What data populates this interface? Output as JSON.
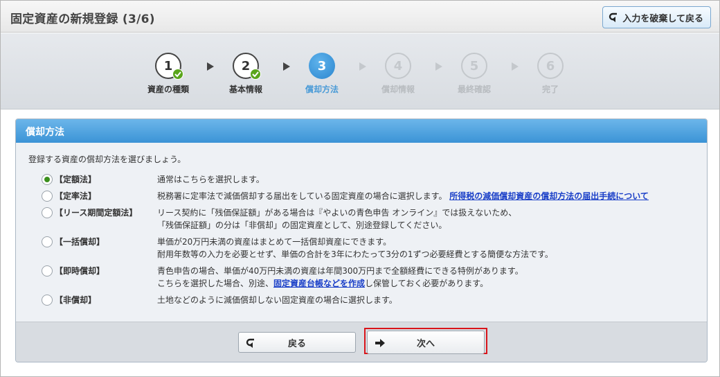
{
  "header": {
    "title": "固定資産の新規登録 (3/6)",
    "discard_label": "入力を破棄して戻る"
  },
  "steps": [
    {
      "num": "1",
      "label": "資産の種類",
      "state": "done"
    },
    {
      "num": "2",
      "label": "基本情報",
      "state": "done"
    },
    {
      "num": "3",
      "label": "償却方法",
      "state": "active"
    },
    {
      "num": "4",
      "label": "償却情報",
      "state": "future"
    },
    {
      "num": "5",
      "label": "最終確認",
      "state": "future"
    },
    {
      "num": "6",
      "label": "完了",
      "state": "future"
    }
  ],
  "panel": {
    "title": "償却方法",
    "intro": "登録する資産の償却方法を選びましょう。",
    "options": [
      {
        "name": "【定額法】",
        "selected": true,
        "lines": [
          "通常はこちらを選択します。"
        ]
      },
      {
        "name": "【定率法】",
        "selected": false,
        "lines": [
          "税務署に定率法で減価償却する届出をしている固定資産の場合に選択します。"
        ],
        "link": "所得税の減価償却資産の償却方法の届出手続について"
      },
      {
        "name": "【リース期間定額法】",
        "selected": false,
        "lines": [
          "リース契約に「残価保証額」がある場合は『やよいの青色申告 オンライン』では扱えないため、",
          "「残価保証額」の分は「非償却」の固定資産として、別途登録してください。"
        ]
      },
      {
        "name": "【一括償却】",
        "selected": false,
        "lines": [
          "単価が20万円未満の資産はまとめて一括償却資産にできます。",
          "耐用年数等の入力を必要とせず、単価の合計を3年にわたって3分の1ずつ必要経費とする簡便な方法です。"
        ]
      },
      {
        "name": "【即時償却】",
        "selected": false,
        "lines": [
          "青色申告の場合、単価が40万円未満の資産は年間300万円まで全額経費にできる特例があります。"
        ],
        "line2_pre": "こちらを選択した場合、別途、",
        "line2_link": "固定資産台帳などを作成",
        "line2_post": "し保管しておく必要があります。"
      },
      {
        "name": "【非償却】",
        "selected": false,
        "lines": [
          "土地などのように減価償却しない固定資産の場合に選択します。"
        ]
      }
    ]
  },
  "footer": {
    "back_label": "戻る",
    "next_label": "次へ"
  },
  "colors": {
    "accent": "#3b93d6",
    "highlight": "#d9141a",
    "done_check": "#5aa51c"
  }
}
